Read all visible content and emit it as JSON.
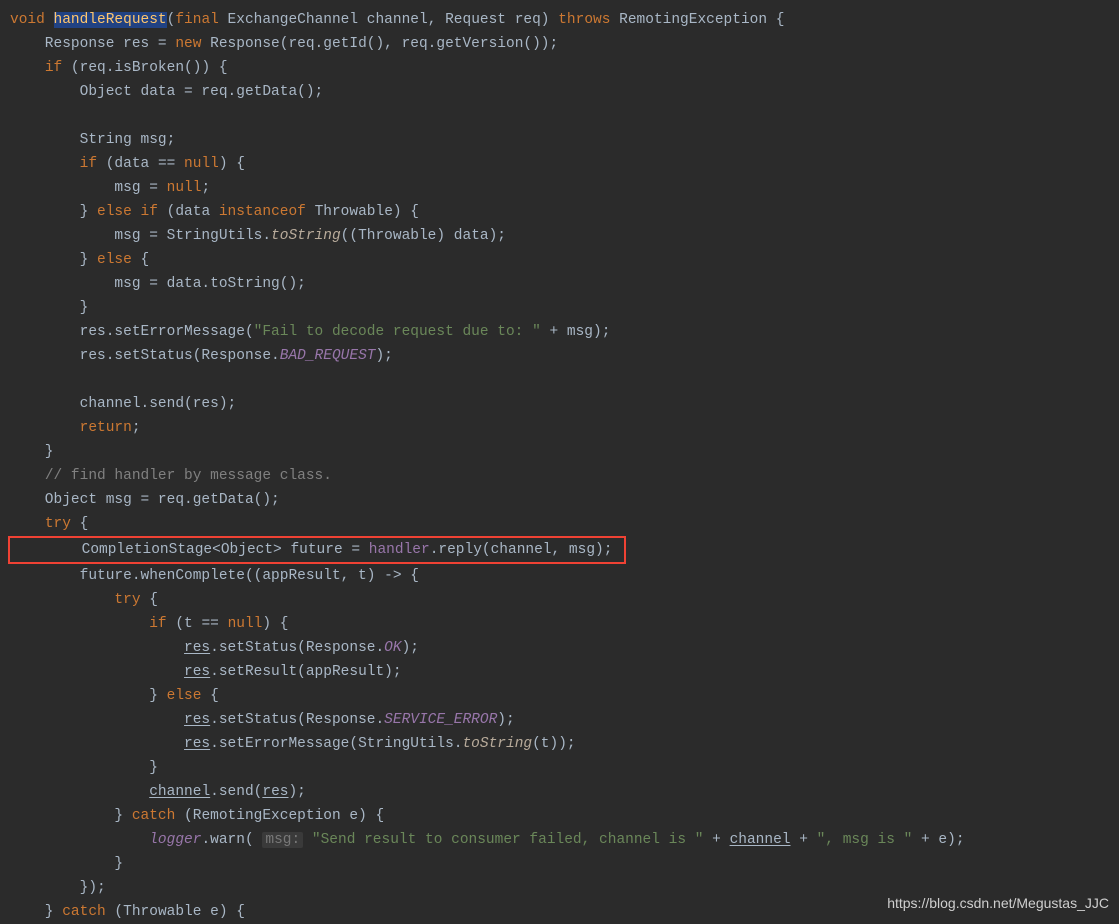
{
  "code": {
    "l1": {
      "void": "void",
      "sp": " ",
      "handleRequest": "handleRequest",
      "open": "(",
      "final": "final",
      "sp2": " ExchangeChannel channel, Request req) ",
      "throws": "throws",
      "rest": " RemotingException {"
    },
    "l2": {
      "pre": "    Response res = ",
      "new": "new",
      "rest": " Response(req.getId(), req.getVersion());"
    },
    "l3": {
      "pre": "    ",
      "if": "if",
      "rest": " (req.isBroken()) {"
    },
    "l4": "        Object data = req.getData();",
    "l5": "",
    "l6": "        String msg;",
    "l7": {
      "pre": "        ",
      "if": "if",
      "mid": " (data == ",
      "null": "null",
      "rest": ") {"
    },
    "l8": {
      "pre": "            msg = ",
      "null": "null",
      "semi": ";"
    },
    "l9": {
      "pre": "        } ",
      "else": "else if",
      "mid": " (data ",
      "inst": "instanceof",
      "rest": " Throwable) {"
    },
    "l10": {
      "pre": "            msg = StringUtils.",
      "ts": "toString",
      "rest": "((Throwable) data);"
    },
    "l11": {
      "pre": "        } ",
      "else": "else",
      "rest": " {"
    },
    "l12": "            msg = data.toString();",
    "l13": "        }",
    "l14": {
      "pre": "        res.setErrorMessage(",
      "str": "\"Fail to decode request due to: \"",
      "rest": " + msg);"
    },
    "l15": {
      "pre": "        res.setStatus(Response.",
      "c": "BAD_REQUEST",
      "rest": ");"
    },
    "l16": "",
    "l17": "        channel.send(res);",
    "l18": {
      "pre": "        ",
      "ret": "return",
      "semi": ";"
    },
    "l19": "    }",
    "l20": {
      "pre": "    ",
      "com": "// find handler by message class."
    },
    "l21": "    Object msg = req.getData();",
    "l22": {
      "pre": "    ",
      "try": "try",
      "rest": " {"
    },
    "l23": {
      "pre": "        CompletionStage<Object> future = ",
      "handler": "handler",
      "rest": ".reply(channel, msg);"
    },
    "l24": "        future.whenComplete((appResult, t) -> {",
    "l25": {
      "pre": "            ",
      "try": "try",
      "rest": " {"
    },
    "l26": {
      "pre": "                ",
      "if": "if",
      "mid": " (t == ",
      "null": "null",
      "rest": ") {"
    },
    "l27": {
      "pre": "                    ",
      "res": "res",
      "mid": ".setStatus(Response.",
      "ok": "OK",
      "rest": ");"
    },
    "l28": {
      "pre": "                    ",
      "res": "res",
      "rest": ".setResult(appResult);"
    },
    "l29": {
      "pre": "                } ",
      "else": "else",
      "rest": " {"
    },
    "l30": {
      "pre": "                    ",
      "res": "res",
      "mid": ".setStatus(Response.",
      "se": "SERVICE_ERROR",
      "rest": ");"
    },
    "l31": {
      "pre": "                    ",
      "res": "res",
      "mid": ".setErrorMessage(StringUtils.",
      "ts": "toString",
      "rest": "(t));"
    },
    "l32": "                }",
    "l33": {
      "pre": "                ",
      "ch": "channel",
      "mid": ".send(",
      "res": "res",
      "rest": ");"
    },
    "l34": {
      "pre": "            } ",
      "catch": "catch",
      "rest": " (RemotingException e) {"
    },
    "l35": {
      "pre": "                ",
      "logger": "logger",
      "mid": ".warn( ",
      "hint": "msg:",
      "sp": " ",
      "str": "\"Send result to consumer failed, channel is \"",
      "plus": " + ",
      "ch": "channel",
      "plus2": " + ",
      "str2": "\", msg is \"",
      "rest": " + e);"
    },
    "l36": "            }",
    "l37": "        });",
    "l38": {
      "pre": "    } ",
      "catch": "catch",
      "rest": " (Throwable e) {"
    }
  },
  "watermark": "https://blog.csdn.net/Megustas_JJC"
}
